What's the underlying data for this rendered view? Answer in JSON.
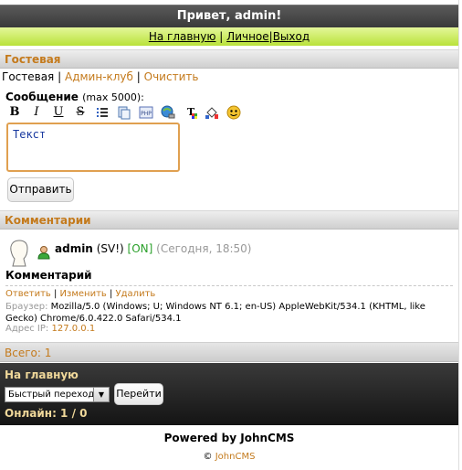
{
  "header": {
    "greeting": "Привет, admin!"
  },
  "topnav": {
    "home": "На главную",
    "sep1": "|",
    "personal": "Личное",
    "sep2": "|",
    "logout": "Выход"
  },
  "section_guestbook": "Гостевая",
  "tabs": {
    "current": "Гостевая",
    "sep1": "|",
    "admin_club": "Админ-клуб",
    "sep2": "|",
    "clear": "Очистить"
  },
  "form": {
    "label": "Сообщение",
    "max": "(max 5000):",
    "text_value": "Текст",
    "toolbar": [
      "bold-icon",
      "italic-icon",
      "underline-icon",
      "strikethrough-icon",
      "list-icon",
      "quote-icon",
      "php-code-icon",
      "link-icon",
      "color-icon",
      "background-color-icon",
      "smiley-icon"
    ],
    "submit": "Отправить"
  },
  "section_comments": "Комментарии",
  "comment": {
    "author": "admin",
    "rights": "(SV!)",
    "status": "[ON]",
    "time": "(Сегодня, 18:50)",
    "title": "Комментарий",
    "actions": {
      "reply": "Ответить",
      "sep1": "|",
      "edit": "Изменить",
      "sep2": "|",
      "delete": "Удалить"
    },
    "browser_label": "Браузер:",
    "browser": "Mozilla/5.0 (Windows; U; Windows NT 6.1; en-US) AppleWebKit/534.1 (KHTML, like Gecko) Chrome/6.0.422.0 Safari/534.1",
    "ip_label": "Адрес IP:",
    "ip": "127.0.0.1"
  },
  "total": "Всего: 1",
  "footer": {
    "home": "На главную",
    "quick_jump": "Быстрый переход",
    "go": "Перейти",
    "online": "Онлайн: 1 / 0"
  },
  "powered": "Powered by JohnCMS",
  "copyright": {
    "symbol": "©",
    "name": "JohnCMS"
  },
  "colors": {
    "accent": "#c47a1c",
    "online": "#2aa02a",
    "nav_bg": "#c6e84a",
    "footer_text": "#f0d89a"
  }
}
